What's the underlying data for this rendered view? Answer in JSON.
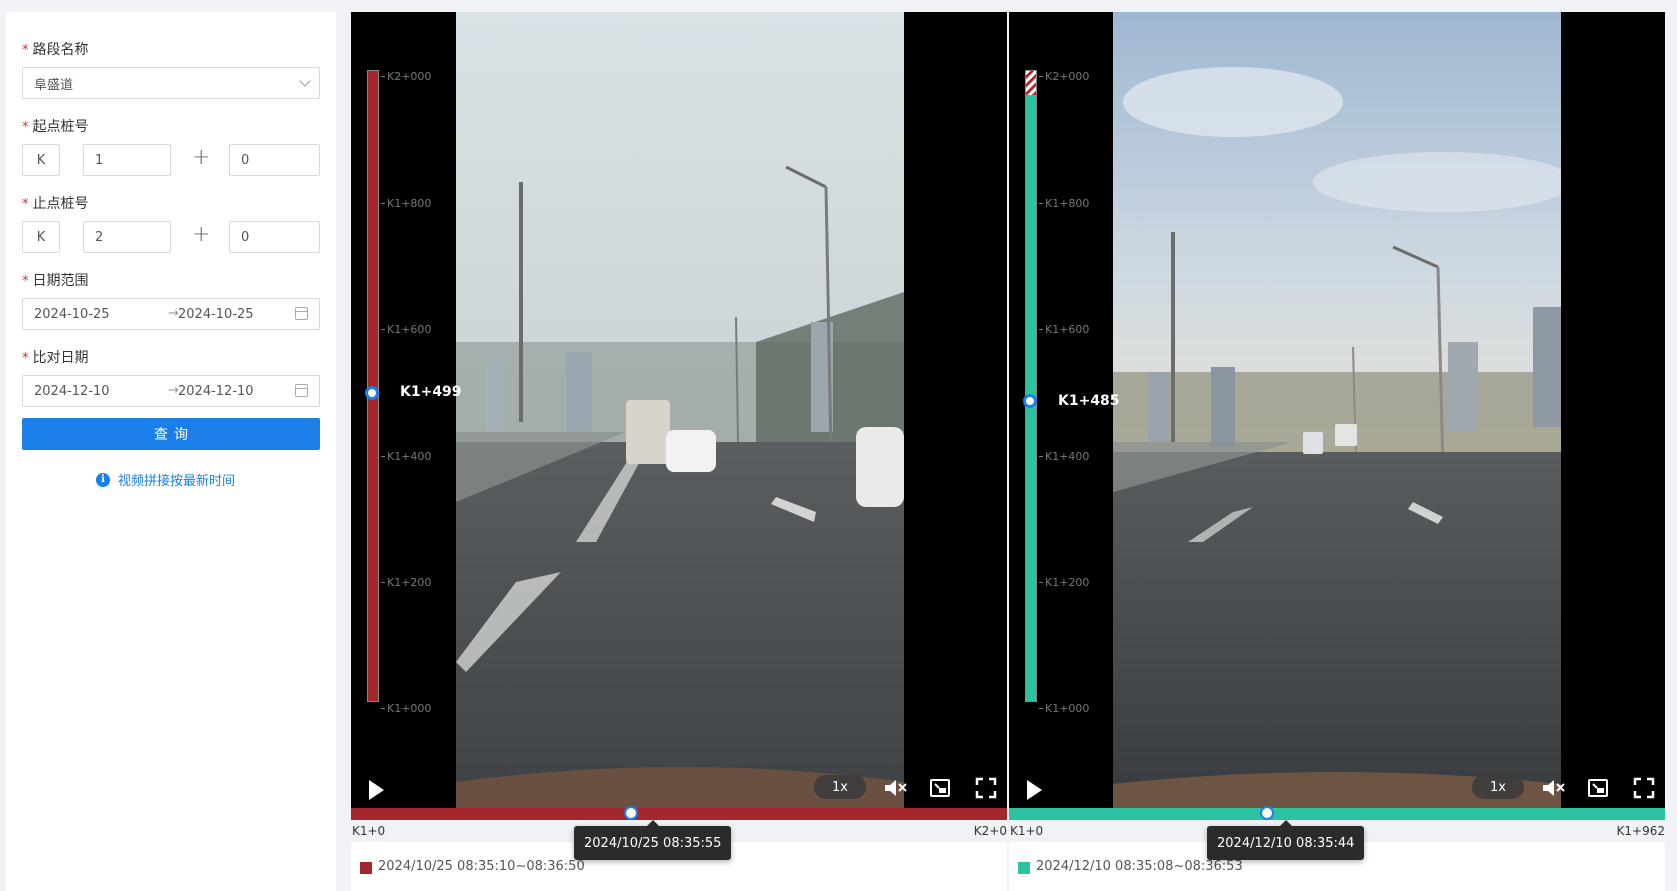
{
  "form": {
    "road_label": "路段名称",
    "road_value": "阜盛道",
    "start_label": "起点桩号",
    "start_prefix": "K",
    "start_km": "1",
    "start_m": "0",
    "end_label": "止点桩号",
    "end_prefix": "K",
    "end_km": "2",
    "end_m": "0",
    "date_label": "日期范围",
    "date_from": "2024-10-25",
    "date_to": "2024-10-25",
    "compare_label": "比对日期",
    "compare_from": "2024-12-10",
    "compare_to": "2024-12-10",
    "required_mark": "*",
    "plus": "+",
    "range_arrow": "→",
    "query_label": "查询",
    "info_text": "视频拼接按最新时间"
  },
  "videos": [
    {
      "color": "#a3272c",
      "ticks": [
        "K2+000",
        "K1+800",
        "K1+600",
        "K1+400",
        "K1+200",
        "K1+000"
      ],
      "marker_label": "K1+499",
      "speed": "1x",
      "range_start": "K1+0",
      "range_end": "K2+0",
      "legend": "2024/10/25 08:35:10~08:36:50",
      "tooltip": "2024/10/25 08:35:55",
      "progress": 0.427
    },
    {
      "color": "#2cc2a2",
      "ticks": [
        "K2+000",
        "K1+800",
        "K1+600",
        "K1+400",
        "K1+200",
        "K1+000"
      ],
      "marker_label": "K1+485",
      "speed": "1x",
      "range_start": "K1+0",
      "range_end": "K1+962",
      "legend": "2024/12/10 08:35:08~08:36:53",
      "tooltip": "2024/12/10 08:35:44",
      "progress": 0.394
    }
  ],
  "icons": {
    "play": "play-icon",
    "mute": "mute-icon",
    "pip": "picture-in-picture-icon",
    "fullscreen": "fullscreen-icon",
    "info": "info-icon",
    "calendar": "calendar-icon",
    "dropdown": "chevron-down-icon"
  },
  "colors": {
    "primary": "#1a7fe8",
    "required": "#f5222d"
  }
}
